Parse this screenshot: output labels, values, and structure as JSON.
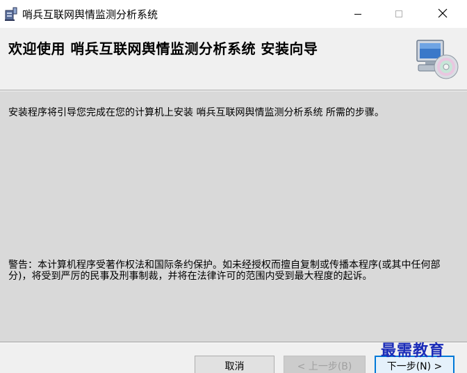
{
  "window": {
    "title": "哨兵互联网舆情监测分析系统",
    "icon": "installer-icon"
  },
  "caption_buttons": {
    "minimize": "minimize-icon",
    "maximize": "maximize-icon",
    "close": "close-icon"
  },
  "banner": {
    "title": "欢迎使用  哨兵互联网舆情监测分析系统  安装向导",
    "icon": "computer-disc-icon"
  },
  "body": {
    "intro": "安装程序将引导您完成在您的计算机上安装 哨兵互联网舆情监测分析系统 所需的步骤。",
    "warning": "警告：本计算机程序受著作权法和国际条约保护。如未经授权而擅自复制或传播本程序(或其中任何部分)，将受到严厉的民事及刑事制裁，并将在法律许可的范围内受到最大程度的起诉。"
  },
  "footer": {
    "cancel_label": "取消",
    "back_label": "< 上一步(B)",
    "next_label": "下一步(N) >"
  },
  "watermark": {
    "text": "最需教育"
  },
  "colors": {
    "body_bg": "#d9d9d9",
    "chrome_bg": "#f0f0f0",
    "focus_border": "#0078d7",
    "watermark": "#1a2bb8"
  }
}
